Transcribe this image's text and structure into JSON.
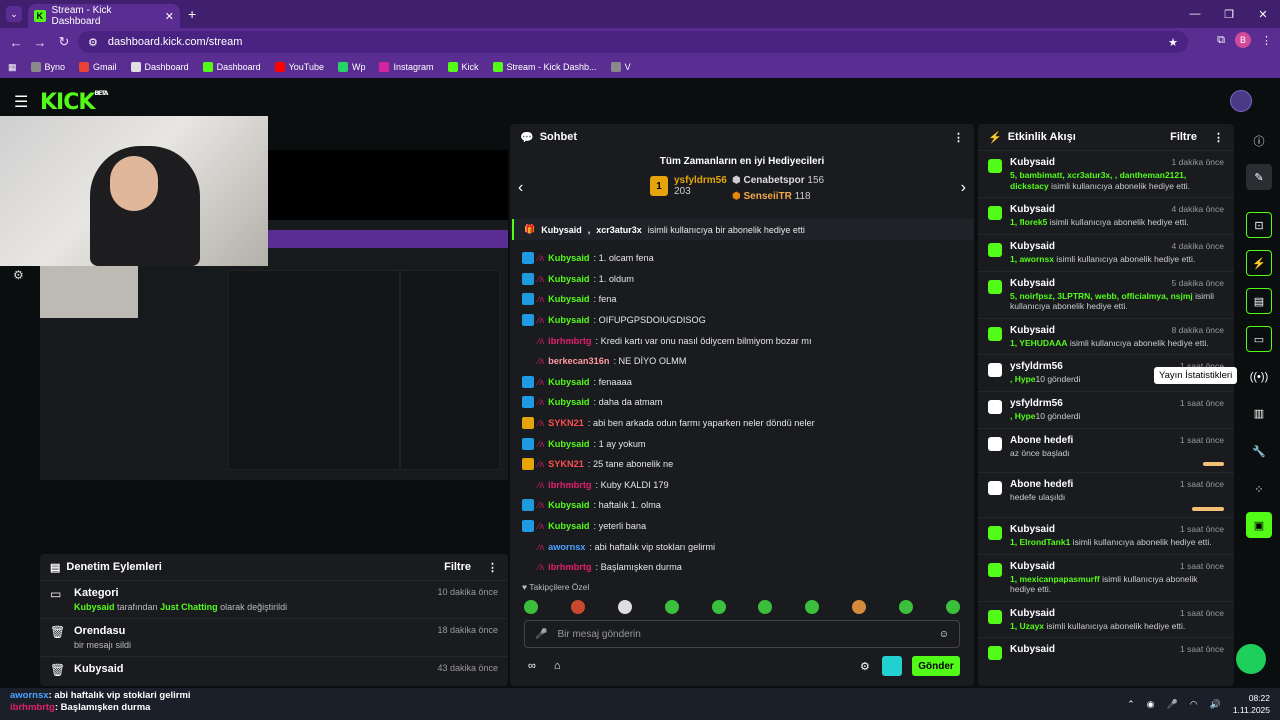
{
  "browser": {
    "tab_title": "Stream - Kick Dashboard",
    "url": "dashboard.kick.com/stream",
    "profile_letter": "B",
    "bookmarks": [
      {
        "label": "Byno",
        "color": "#8a8a8a"
      },
      {
        "label": "Gmail",
        "color": "#ea4335"
      },
      {
        "label": "Dashboard",
        "color": "#e0e0e0"
      },
      {
        "label": "Dashboard",
        "color": "#53fc18"
      },
      {
        "label": "YouTube",
        "color": "#ff0000"
      },
      {
        "label": "Wp",
        "color": "#25d366"
      },
      {
        "label": "Instagram",
        "color": "#d6249f"
      },
      {
        "label": "Kick",
        "color": "#53fc18"
      },
      {
        "label": "Stream - Kick Dashb...",
        "color": "#53fc18"
      },
      {
        "label": "V",
        "color": "#8a8a8a"
      }
    ]
  },
  "kick": {
    "logo": "KICK",
    "beta": "BETA"
  },
  "moderation": {
    "title": "Denetim Eylemleri",
    "filter": "Filtre",
    "rows": [
      {
        "title": "Kategori",
        "time": "10 dakika önce",
        "user": "Kubysaid",
        "mid": " tarafından ",
        "cat": "Just Chatting",
        "tail": " olarak değiştirildi"
      },
      {
        "title": "Orendasu",
        "time": "18 dakika önce",
        "desc": "bir mesajı sildi"
      },
      {
        "title": "Kubysaid",
        "time": "43 dakika önce",
        "desc": ""
      }
    ]
  },
  "chat": {
    "title": "Sohbet",
    "top_gifters_title": "Tüm Zamanların en iyi Hediyecileri",
    "gifter1": {
      "rank": "1",
      "name": "ysfyldrm56",
      "count": "203"
    },
    "gifter2": {
      "name": "Cenabetspor",
      "count": "156"
    },
    "gifter3": {
      "name": "SenseiiTR",
      "count": "118"
    },
    "banner_user": "Kubysaid",
    "banner_user2": "xcr3atur3x",
    "banner_text": "isimli kullanıcıya bir abonelik hediye etti",
    "messages": [
      {
        "user": "Kubysaid",
        "color": "#53fc18",
        "text": ": 1. olcam fena",
        "badge": "#1f9ae0"
      },
      {
        "user": "Kubysaid",
        "color": "#53fc18",
        "text": ": 1. oldum",
        "badge": "#1f9ae0"
      },
      {
        "user": "Kubysaid",
        "color": "#53fc18",
        "text": ": fena",
        "badge": "#1f9ae0"
      },
      {
        "user": "Kubysaid",
        "color": "#53fc18",
        "text": ": OIFUPGPSDOIUGDISOG",
        "badge": "#1f9ae0"
      },
      {
        "user": "ibrhmbrtg",
        "color": "#e0206a",
        "text": ": Kredi kartı var onu nasıl ödiycem bilmiyom bozar mı",
        "badge": "#191b1f"
      },
      {
        "user": "berkecan316n",
        "color": "#ff9aa2",
        "text": ": NE DİYO OLMM",
        "badge": "#191b1f"
      },
      {
        "user": "Kubysaid",
        "color": "#53fc18",
        "text": ": fenaaaa",
        "badge": "#1f9ae0"
      },
      {
        "user": "Kubysaid",
        "color": "#53fc18",
        "text": ": daha da atmam",
        "badge": "#1f9ae0"
      },
      {
        "user": "SYKN21",
        "color": "#ff4d4d",
        "text": ": abi ben arkada odun farmı yaparken neler döndü neler",
        "badge": "#e5a50a"
      },
      {
        "user": "Kubysaid",
        "color": "#53fc18",
        "text": ": 1 ay yokum",
        "badge": "#1f9ae0"
      },
      {
        "user": "SYKN21",
        "color": "#ff4d4d",
        "text": ": 25 tane abonelik ne",
        "badge": "#e5a50a"
      },
      {
        "user": "ibrhmbrtg",
        "color": "#e0206a",
        "text": ": Kuby KALDI 179",
        "badge": "#191b1f"
      },
      {
        "user": "Kubysaid",
        "color": "#53fc18",
        "text": ": haftalık 1. olma",
        "badge": "#1f9ae0"
      },
      {
        "user": "Kubysaid",
        "color": "#53fc18",
        "text": ": yeterli bana",
        "badge": "#1f9ae0"
      },
      {
        "user": "awornsx",
        "color": "#4aa3ff",
        "text": ": abi haftalık vip stokları gelirmi",
        "badge": "#191b1f"
      },
      {
        "user": "ibrhmbrtg",
        "color": "#e0206a",
        "text": ": Başlamışken durma",
        "badge": "#191b1f"
      }
    ],
    "followers_special": "Takipçilere Özel",
    "input_placeholder": "Bir mesaj gönderin",
    "send": "Gönder"
  },
  "feed": {
    "title": "Etkinlik Akışı",
    "filter": "Filtre",
    "tooltip": "Yayın İstatistikleri",
    "items": [
      {
        "who": "Kubysaid",
        "time": "1 dakika önce",
        "hl": "5, bambimatt, xcr3atur3x, , dantheman2121, dickstacy",
        "rest": " isimli kullanıcıya abonelik hediye etti.",
        "icon": "#53fc18"
      },
      {
        "who": "Kubysaid",
        "time": "4 dakika önce",
        "hl": "1, florek5",
        "rest": " isimli kullanıcıya abonelik hediye etti.",
        "icon": "#53fc18"
      },
      {
        "who": "Kubysaid",
        "time": "4 dakika önce",
        "hl": "1, awornsx",
        "rest": " isimli kullanıcıya abonelik hediye etti.",
        "icon": "#53fc18"
      },
      {
        "who": "Kubysaid",
        "time": "5 dakika önce",
        "hl": "5, noirfpsz, 3LPTRN, webb, officialmya, nsjmj",
        "rest": " isimli kullanıcıya abonelik hediye etti.",
        "icon": "#53fc18"
      },
      {
        "who": "Kubysaid",
        "time": "8 dakika önce",
        "hl": "1, YEHUDAAA",
        "rest": " isimli kullanıcıya abonelik hediye etti.",
        "icon": "#53fc18"
      },
      {
        "who": "ysfyldrm56",
        "time": "1 saat önce",
        "hl": ", Hype",
        "rest": "10 gönderdi",
        "icon": "#ffffff"
      },
      {
        "who": "ysfyldrm56",
        "time": "1 saat önce",
        "hl": ", Hype",
        "rest": "10 gönderdi",
        "icon": "#ffffff"
      },
      {
        "who": "Abone hedefi",
        "time": "1 saat önce",
        "hl": "",
        "rest": "az önce başladı",
        "icon": "#ffffff",
        "bar": 0.65
      },
      {
        "who": "Abone hedefi",
        "time": "1 saat önce",
        "hl": "",
        "rest": "hedefe ulaşıldı",
        "icon": "#ffffff",
        "bar": 1.0
      },
      {
        "who": "Kubysaid",
        "time": "1 saat önce",
        "hl": "1, ElrondTank1",
        "rest": " isimli kullanıcıya abonelik hediye etti.",
        "icon": "#53fc18"
      },
      {
        "who": "Kubysaid",
        "time": "1 saat önce",
        "hl": "1, mexicanpapasmurff",
        "rest": " isimli kullanıcıya abonelik hediye etti.",
        "icon": "#53fc18"
      },
      {
        "who": "Kubysaid",
        "time": "1 saat önce",
        "hl": "1, Uzayx",
        "rest": " isimli kullanıcıya abonelik hediye etti.",
        "icon": "#53fc18"
      },
      {
        "who": "Kubysaid",
        "time": "1 saat önce",
        "hl": "",
        "rest": "",
        "icon": "#53fc18"
      }
    ]
  },
  "ticker": {
    "line1_user": "awornsx",
    "line1_text": ": abi haftalık vip stoklari gelirmi",
    "line2_user": "ibrhmbrtg",
    "line2_text": ": Başlamışken durma"
  },
  "taskbar": {
    "time": "08:22",
    "date": "1.11.2025"
  },
  "colors": {
    "accent": "#53fc18",
    "chrome": "#5a2d92",
    "panel": "#191b1f"
  }
}
